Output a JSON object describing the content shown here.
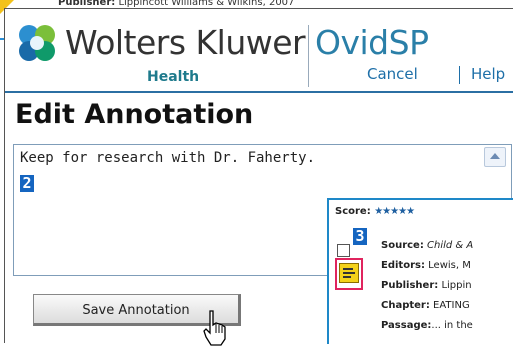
{
  "background": {
    "publisher_label": "Publisher:",
    "publisher_value": "Lippincott Williams & Wilkins, 2007"
  },
  "header": {
    "brand": "Wolters Kluwer",
    "brand_sub": "Health",
    "product": "OvidSP",
    "cancel_label": "Cancel",
    "help_label": "Help"
  },
  "page_title": "Edit Annotation",
  "annotation": {
    "text": "Keep for research with Dr. Faherty.",
    "badge": "2"
  },
  "save_button": "Save Annotation",
  "result_panel": {
    "score_label": "Score:",
    "stars": "★★★★★",
    "badge": "3",
    "source_label": "Source:",
    "source_value": "Child & A",
    "editors_label": "Editors:",
    "editors_value": "Lewis, M",
    "publisher_label": "Publisher:",
    "publisher_value": "Lippin",
    "chapter_label": "Chapter:",
    "chapter_value": "EATING",
    "passage_label": "Passage:",
    "passage_value": "... in the"
  },
  "colors": {
    "brand_blue": "#2a7fa8",
    "badge_blue": "#1565c0",
    "note_yellow": "#f4d21a",
    "highlight_pink": "#e0245e"
  }
}
